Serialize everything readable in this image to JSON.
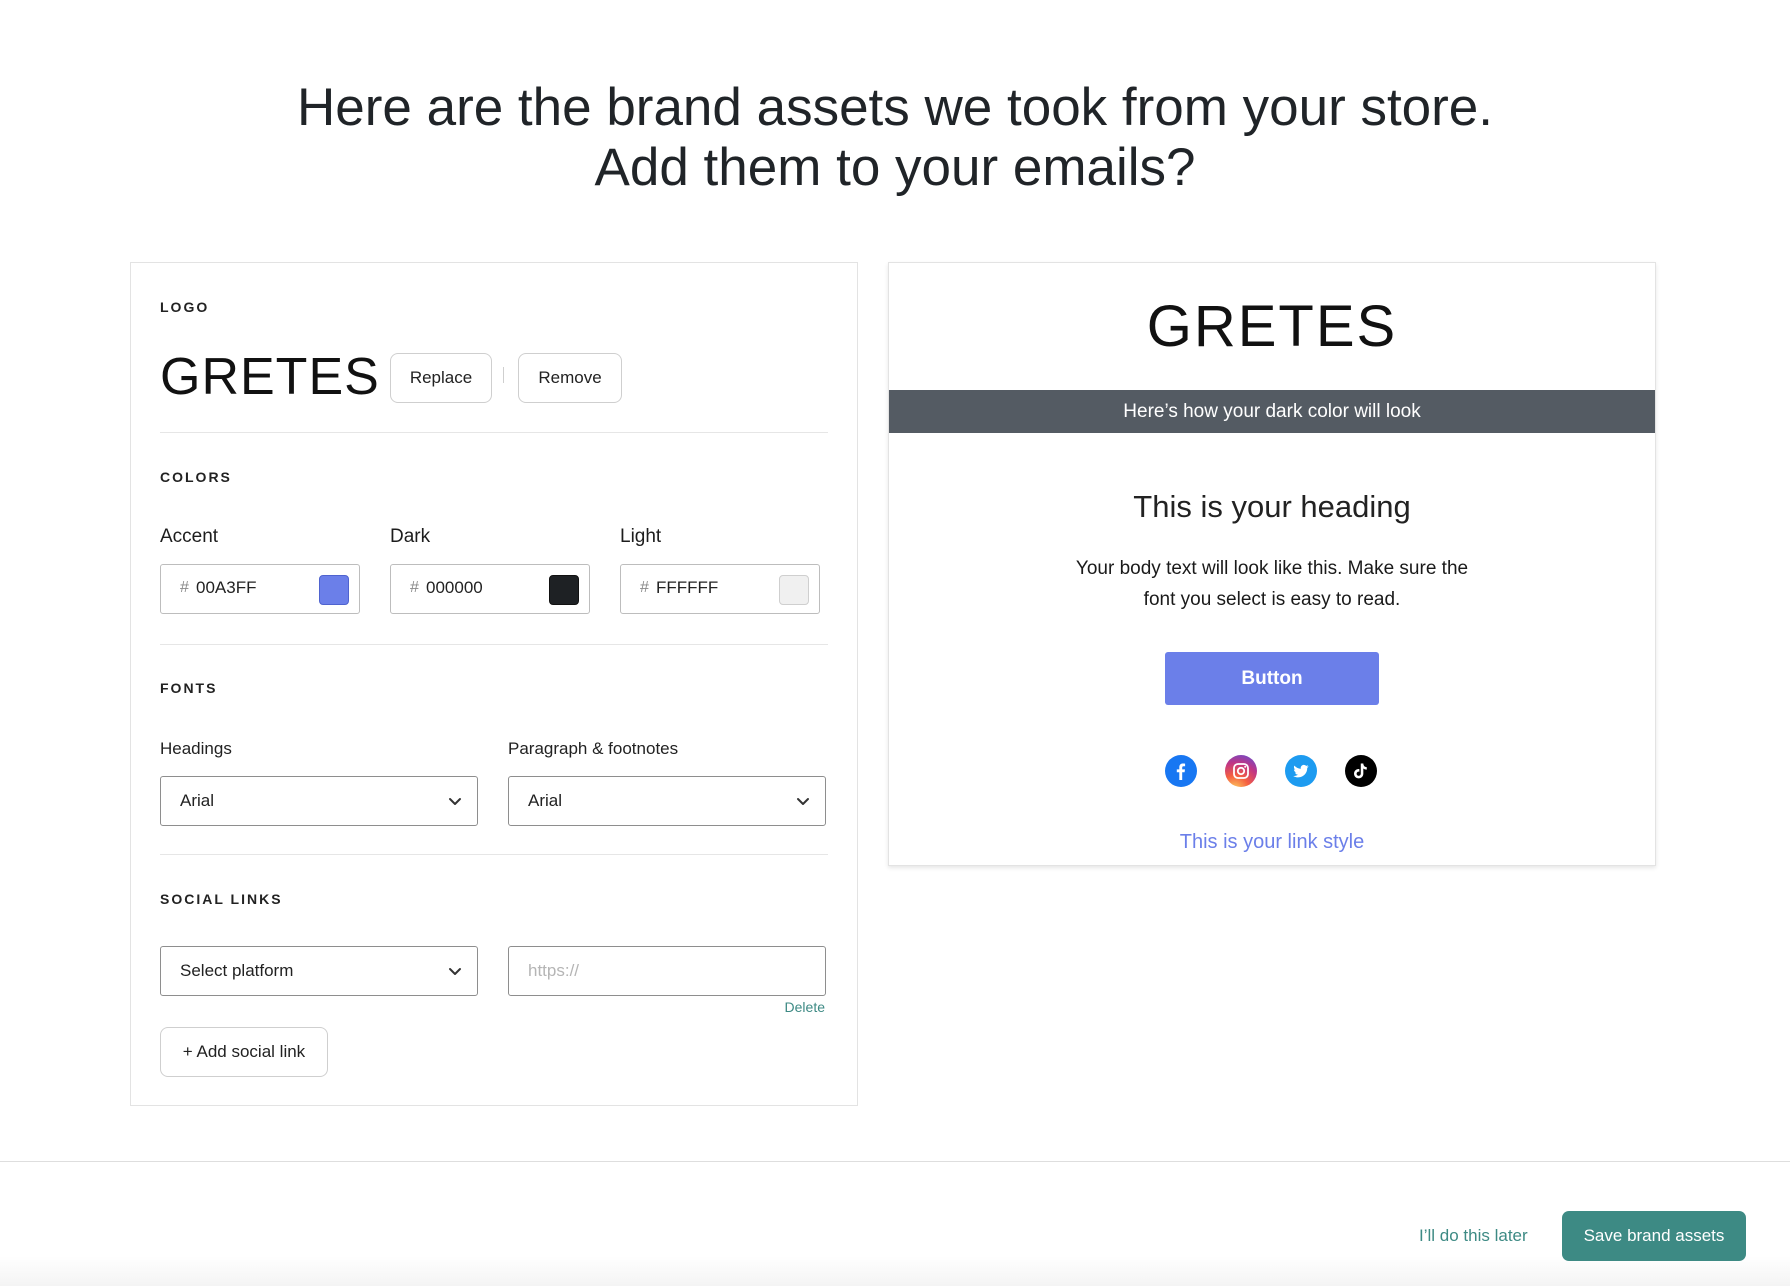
{
  "header": {
    "title_line1": "Here are the brand assets we took from your store.",
    "title_line2": "Add them to your emails?"
  },
  "logo": {
    "section_label": "LOGO",
    "brand_text": "GRETES",
    "replace_label": "Replace",
    "remove_label": "Remove"
  },
  "colors": {
    "section_label": "COLORS",
    "hash_symbol": "#",
    "fields": [
      {
        "label": "Accent",
        "hex": "00A3FF",
        "swatch_color": "#6b7fe9"
      },
      {
        "label": "Dark",
        "hex": "000000",
        "swatch_color": "#1e2124"
      },
      {
        "label": "Light",
        "hex": "FFFFFF",
        "swatch_color": "#f0f0f0"
      }
    ]
  },
  "fonts": {
    "section_label": "FONTS",
    "headings_label": "Headings",
    "headings_value": "Arial",
    "paragraph_label": "Paragraph & footnotes",
    "paragraph_value": "Arial"
  },
  "social": {
    "section_label": "SOCIAL LINKS",
    "platform_value": "Select platform",
    "url_placeholder": "https://",
    "delete_label": "Delete",
    "add_label": "+ Add social link"
  },
  "preview": {
    "brand_text": "GRETES",
    "dark_bar_text": "Here’s how your dark color will look",
    "heading": "This is your heading",
    "body_text": "Your body text will look like this. Make sure the font you select is easy to read.",
    "button_label": "Button",
    "link_text": "This is your link style",
    "social_icons": [
      "facebook-icon",
      "instagram-icon",
      "twitter-icon",
      "tiktok-icon"
    ]
  },
  "footer": {
    "later_label": "I’ll do this later",
    "save_label": "Save brand assets"
  },
  "theme": {
    "accent": "#6b7fe9",
    "dark_bar": "#545b63",
    "primary_action": "#3d8a84"
  }
}
